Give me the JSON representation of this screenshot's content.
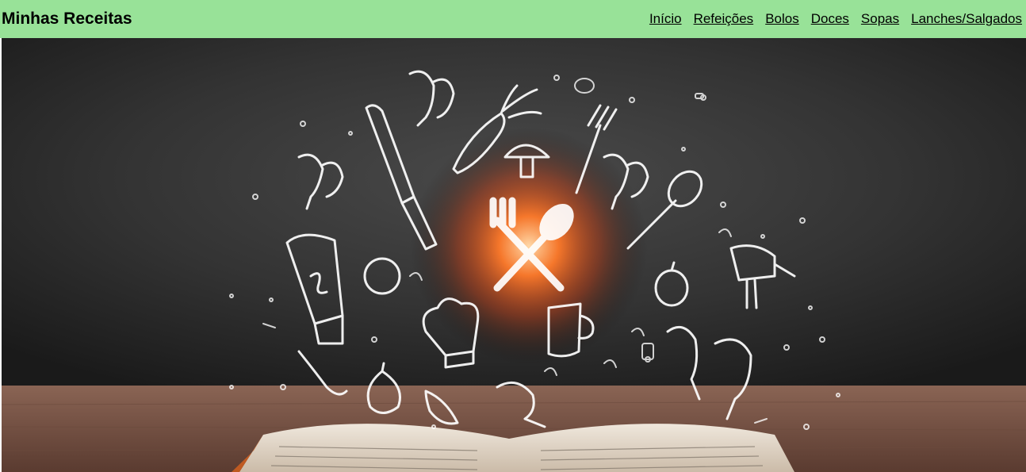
{
  "header": {
    "title": "Minhas Receitas",
    "nav": [
      {
        "label": "Início"
      },
      {
        "label": "Refeições"
      },
      {
        "label": "Bolos"
      },
      {
        "label": "Doces"
      },
      {
        "label": "Sopas"
      },
      {
        "label": "Lanches/Salgados"
      }
    ],
    "background_color": "#98e298"
  },
  "hero": {
    "description_icon": "cookbook-kitchen-doodles-image",
    "board_color": "#2a2a2a",
    "glow_color": "#ff6a1a",
    "table_color": "#7a5544"
  }
}
